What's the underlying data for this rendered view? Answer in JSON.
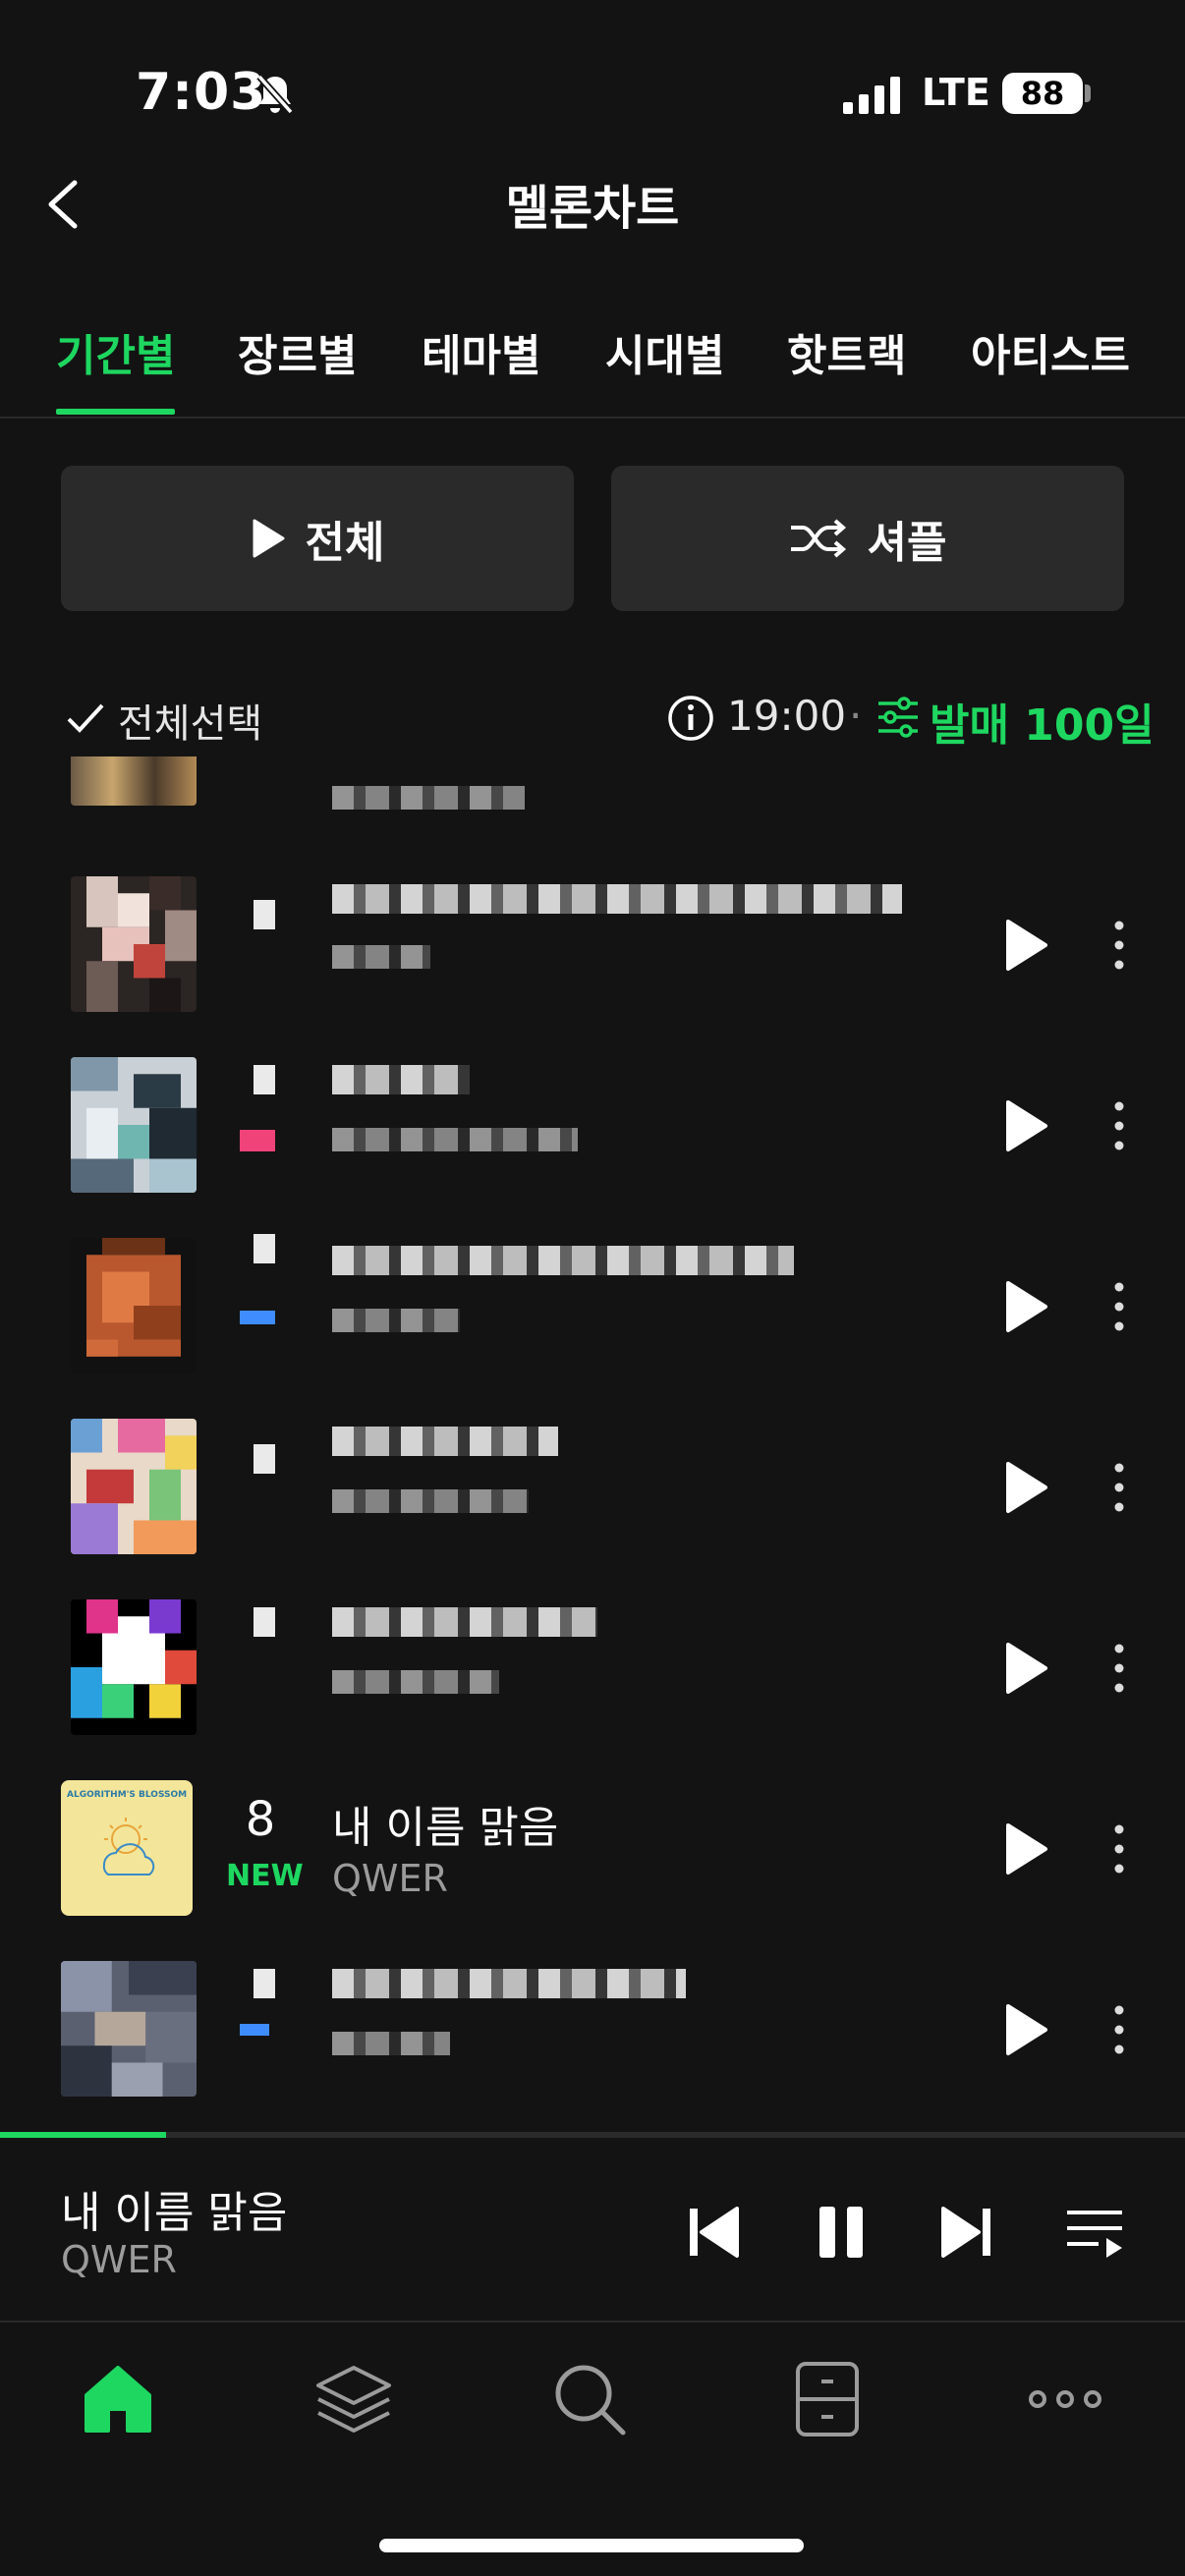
{
  "status_bar": {
    "time": "7:03",
    "network": "LTE",
    "battery": "88"
  },
  "header": {
    "title": "멜론차트"
  },
  "tabs": [
    {
      "label": "기간별",
      "active": true
    },
    {
      "label": "장르별",
      "active": false
    },
    {
      "label": "테마별",
      "active": false
    },
    {
      "label": "시대별",
      "active": false
    },
    {
      "label": "핫트랙",
      "active": false
    },
    {
      "label": "아티스트",
      "active": false
    }
  ],
  "actions": {
    "play_all_label": "전체",
    "shuffle_label": "셔플"
  },
  "select_row": {
    "select_all_label": "전체선택",
    "update_time": "19:00",
    "separator": "·",
    "filter_label": "발매 100일"
  },
  "songs": [
    {
      "rank": "8",
      "status": "NEW",
      "title": "내 이름 맑음",
      "artist": "QWER",
      "album_art_text": "ALGORITHM'S BLOSSOM"
    }
  ],
  "now_playing": {
    "title": "내 이름 맑음",
    "artist": "QWER",
    "progress": 0.14
  },
  "colors": {
    "accent": "#1ed760",
    "background": "#131313",
    "surface": "#2a2a2a",
    "rank_up": "#f0437a",
    "rank_down": "#3f8cff"
  },
  "icons": {
    "back": "chevron-left-icon",
    "play": "play-icon",
    "shuffle": "shuffle-icon",
    "check": "check-icon",
    "info": "info-icon",
    "filter": "filter-sliders-icon",
    "more": "more-vertical-icon",
    "prev": "skip-previous-icon",
    "pause": "pause-icon",
    "next": "skip-next-icon",
    "queue": "playlist-icon",
    "home": "home-icon",
    "library": "layers-icon",
    "search": "search-icon",
    "storage": "drawer-icon",
    "menu": "more-horizontal-icon"
  }
}
